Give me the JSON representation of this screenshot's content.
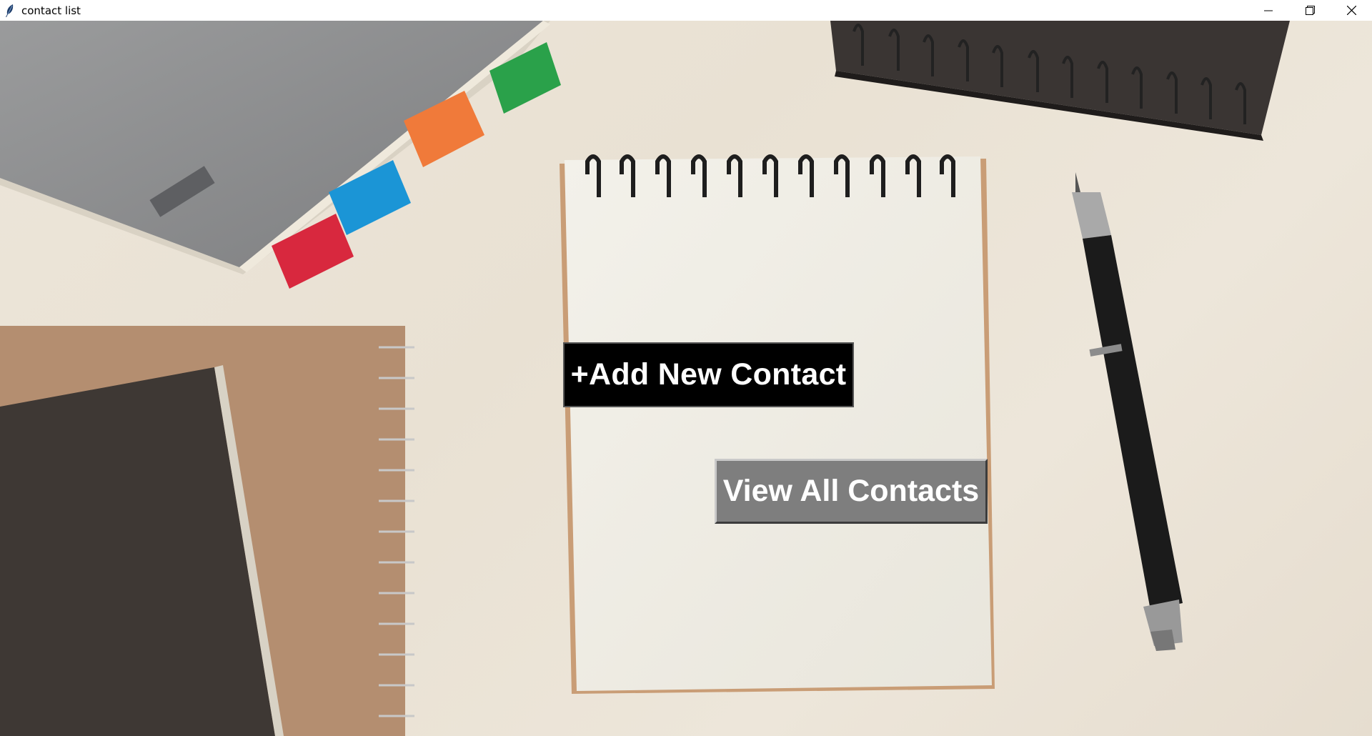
{
  "window": {
    "title": "contact list",
    "icon": "feather-icon",
    "controls": [
      "minimize-icon",
      "restore-icon",
      "close-icon"
    ]
  },
  "buttons": {
    "add_label": "+Add New Contact",
    "view_label": "View All Contacts"
  },
  "colors": {
    "add_bg": "#000000",
    "view_bg": "#7e7e7e",
    "button_text": "#ffffff"
  }
}
